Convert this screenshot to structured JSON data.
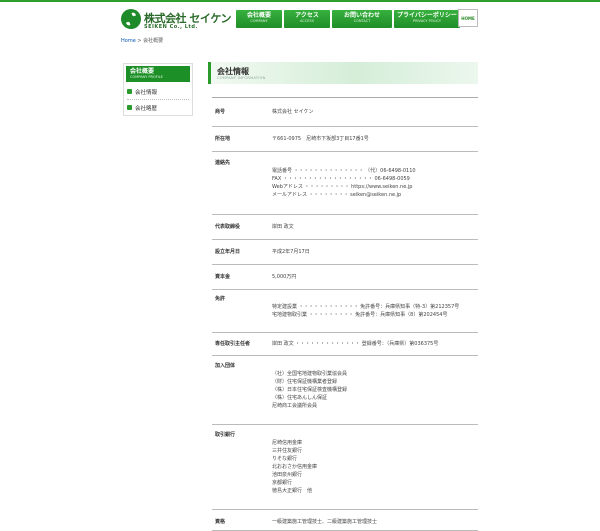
{
  "logo": {
    "name_jp": "株式会社 セイケン",
    "name_en": "SEIKEN Co., Ltd."
  },
  "nav": [
    {
      "jp": "会社概要",
      "en": "COMPANY"
    },
    {
      "jp": "アクセス",
      "en": "ACCESS"
    },
    {
      "jp": "お問い合わせ",
      "en": "CONTACT"
    },
    {
      "jp": "プライバシーポリシー",
      "en": "PRIVACY POLICY"
    }
  ],
  "home_label": "HOME",
  "breadcrumb": {
    "home": "Home",
    "sep": ">",
    "current": "会社概要"
  },
  "sidebar": {
    "title": "会社概要",
    "subtitle": "COMPANY PROFILE",
    "items": [
      "会社情報",
      "会社略歴"
    ]
  },
  "heading": {
    "title": "会社情報",
    "subtitle": "COMPANY INFORMATION"
  },
  "table": [
    {
      "label": "商号",
      "lines": [
        "株式会社 セイケン"
      ]
    },
    {
      "label": "所在地",
      "lines": [
        "〒661-0975　尼崎市下坂部3丁目17番1号"
      ]
    },
    {
      "label": "連絡先",
      "lines": [
        "",
        "電話番号 ・・・・・・・・・・・・・・ （代）06-6498-0110",
        "FAX ・・・・・・・・・・・・・・・・・・ 06-6498-0059",
        "Webアドレス ・・・・・・・・・ https://www.seiken.ne.jp",
        "メールアドレス ・・・・・・・・ seiken@seiken.ne.jp",
        ""
      ]
    },
    {
      "label": "代表取締役",
      "lines": [
        "岸田 政文"
      ]
    },
    {
      "label": "設立年月日",
      "lines": [
        "平成2年7月17日"
      ]
    },
    {
      "label": "資本金",
      "lines": [
        "5,000万円"
      ]
    },
    {
      "label": "免許",
      "lines": [
        "",
        "特定建設業 ・・・・・・・・・・・・ 免許番号：兵庫県知事（特-3）第212357号",
        "宅地建物取引業 ・・・・・・・・・ 免許番号：兵庫県知事（8）第202454号",
        ""
      ]
    },
    {
      "label": "専任取引主任者",
      "lines": [
        "岸田 政文 ・・・・・・・・・・・・・ 登録番号：（兵庫県）第036375号"
      ]
    },
    {
      "label": "加入団体",
      "lines": [
        "",
        "（社）全国宅地建物取引業協会員",
        "（財）住宅保証機構業者登録",
        "（株）日本住宅保証検査機構登録",
        "（株）住宅あんしん保証",
        "尼崎商工会議所会員",
        ""
      ]
    },
    {
      "label": "取引銀行",
      "lines": [
        "",
        "尼崎信用金庫",
        "三井住友銀行",
        "りそな銀行",
        "北おおさか信用金庫",
        "池田泉州銀行",
        "京都銀行",
        "徳島大正銀行　他",
        ""
      ]
    },
    {
      "label": "資格",
      "lines": [
        "一級建築施工管理技士、二級建築施工管理技士"
      ]
    }
  ]
}
